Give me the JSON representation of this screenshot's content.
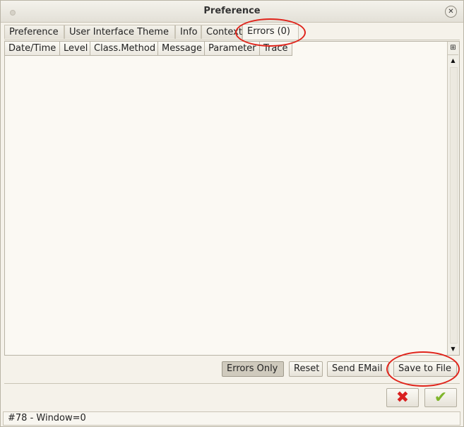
{
  "window": {
    "title": "Preference",
    "close_glyph": "✕"
  },
  "tabs": [
    {
      "label": "Preference"
    },
    {
      "label": "User Interface Theme"
    },
    {
      "label": "Info"
    },
    {
      "label": "Context"
    },
    {
      "label": "Errors (0)",
      "active": true
    }
  ],
  "table": {
    "columns": [
      "Date/Time",
      "Level",
      "Class.Method",
      "Message",
      "Parameter",
      "Trace"
    ],
    "rows": []
  },
  "scrollbar": {
    "corner_icon": "column-control-icon",
    "up_glyph": "▲",
    "down_glyph": "▼"
  },
  "buttons": {
    "errors_only": "Errors Only",
    "reset": "Reset",
    "send_email": "Send EMail",
    "save_to_file": "Save to File"
  },
  "dialog_actions": {
    "cancel_icon": "red-x-icon",
    "ok_icon": "green-check-icon",
    "cancel_glyph": "✖",
    "ok_glyph": "✔"
  },
  "status": {
    "text": "#78 - Window=0"
  },
  "colors": {
    "annotation": "#e0241b",
    "cancel": "#d92020",
    "ok": "#7fb52b"
  }
}
